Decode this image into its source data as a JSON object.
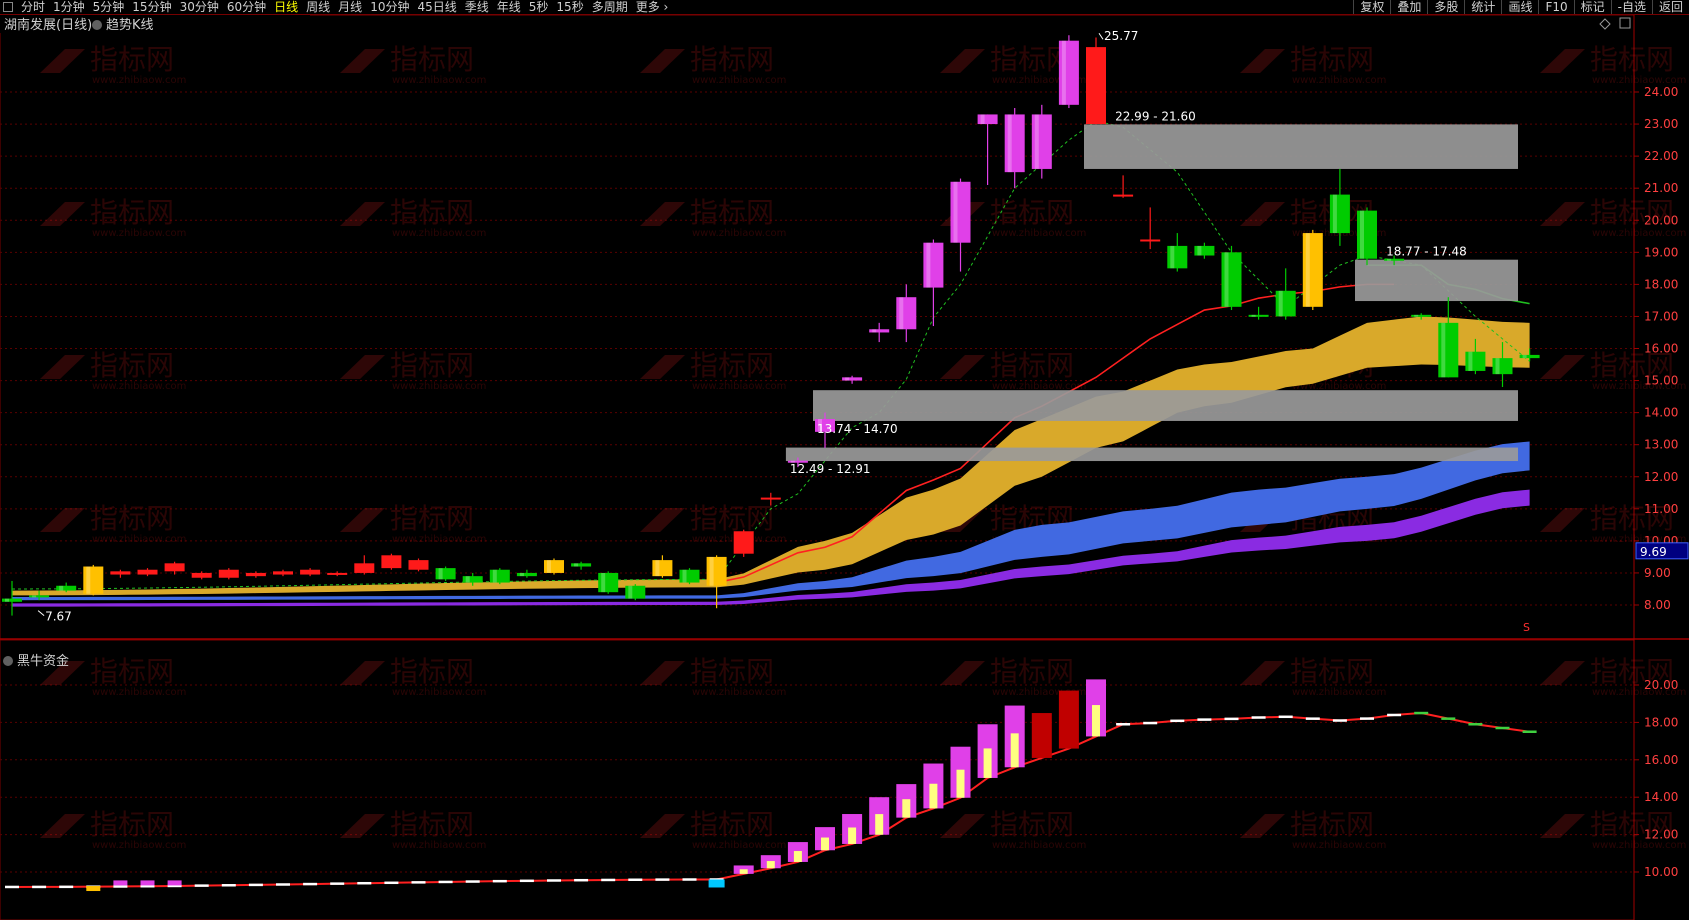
{
  "toolbar": {
    "periods": [
      {
        "label": "分时",
        "active": false
      },
      {
        "label": "1分钟",
        "active": false
      },
      {
        "label": "5分钟",
        "active": false
      },
      {
        "label": "15分钟",
        "active": false
      },
      {
        "label": "30分钟",
        "active": false
      },
      {
        "label": "60分钟",
        "active": false
      },
      {
        "label": "日线",
        "active": true
      },
      {
        "label": "周线",
        "active": false
      },
      {
        "label": "月线",
        "active": false
      },
      {
        "label": "10分钟",
        "active": false
      },
      {
        "label": "45日线",
        "active": false
      },
      {
        "label": "季线",
        "active": false
      },
      {
        "label": "年线",
        "active": false
      },
      {
        "label": "5秒",
        "active": false
      },
      {
        "label": "15秒",
        "active": false
      },
      {
        "label": "多周期",
        "active": false
      },
      {
        "label": "更多",
        "active": false
      }
    ],
    "tools": [
      "复权",
      "叠加",
      "多股",
      "统计",
      "画线",
      "F10",
      "标记",
      "-自选",
      "返回"
    ]
  },
  "main_panel": {
    "title": "湖南发展(日线)",
    "indicator": "趋势K线",
    "price_axis": [
      "24.00",
      "23.00",
      "22.00",
      "21.00",
      "20.00",
      "19.00",
      "18.00",
      "17.00",
      "16.00",
      "15.00",
      "14.00",
      "13.00",
      "12.00",
      "11.00",
      "10.00",
      "9.00",
      "8.00"
    ],
    "current_price": "9.69",
    "high_label": "25.77",
    "low_label": "7.67",
    "zones": [
      {
        "label": "22.99 - 21.60",
        "top": 22.99,
        "bottom": 21.6
      },
      {
        "label": "18.77 - 17.48",
        "top": 18.77,
        "bottom": 17.48
      },
      {
        "label": "13.74 - 14.70",
        "top": 14.7,
        "bottom": 13.74
      },
      {
        "label": "12.49 - 12.91",
        "top": 12.91,
        "bottom": 12.49
      }
    ],
    "marker": "S"
  },
  "sub_panel": {
    "title": "黑牛资金",
    "axis": [
      "20.00",
      "18.00",
      "16.00",
      "14.00",
      "12.00",
      "10.00"
    ]
  },
  "watermark": {
    "text": "指标网",
    "url": "www.zhibiaow.com"
  },
  "colors": {
    "up": "#ff1a1a",
    "down": "#00cc00",
    "magenta": "#e040e8",
    "gold": "#ffc000",
    "band_gold": "#d9a92a",
    "band_blue": "#4169e1",
    "band_purple": "#8a2be2",
    "zone": "#9a9a9a",
    "cyan": "#00c8ff"
  },
  "chart_data": {
    "type": "candlestick",
    "candles": [
      [
        8.2,
        8.1,
        8.75,
        7.67,
        "G"
      ],
      [
        8.25,
        8.3,
        8.45,
        8.15,
        "G"
      ],
      [
        8.45,
        8.6,
        8.7,
        8.4,
        "G"
      ],
      [
        8.35,
        9.2,
        9.25,
        8.3,
        "Y"
      ],
      [
        9.05,
        8.95,
        9.1,
        8.85,
        "R"
      ],
      [
        8.95,
        9.1,
        9.15,
        8.9,
        "R"
      ],
      [
        9.05,
        9.3,
        9.35,
        8.95,
        "R"
      ],
      [
        8.85,
        9.0,
        9.05,
        8.8,
        "R"
      ],
      [
        8.85,
        9.1,
        9.15,
        8.8,
        "R"
      ],
      [
        8.9,
        9.0,
        9.05,
        8.85,
        "R"
      ],
      [
        8.95,
        9.05,
        9.1,
        8.9,
        "R"
      ],
      [
        8.95,
        9.1,
        9.15,
        8.9,
        "R"
      ],
      [
        8.95,
        9.0,
        9.05,
        8.9,
        "R"
      ],
      [
        9.0,
        9.3,
        9.55,
        8.95,
        "R"
      ],
      [
        9.15,
        9.55,
        9.6,
        9.1,
        "R"
      ],
      [
        9.1,
        9.4,
        9.45,
        9.05,
        "R"
      ],
      [
        9.15,
        8.8,
        9.2,
        8.75,
        "G"
      ],
      [
        8.9,
        8.7,
        9.0,
        8.6,
        "G"
      ],
      [
        9.1,
        8.7,
        9.15,
        8.65,
        "G"
      ],
      [
        9.0,
        8.9,
        9.1,
        8.85,
        "G"
      ],
      [
        9.0,
        9.4,
        9.45,
        8.95,
        "Y"
      ],
      [
        9.3,
        9.2,
        9.35,
        9.1,
        "G"
      ],
      [
        9.0,
        8.4,
        9.05,
        8.35,
        "G"
      ],
      [
        8.6,
        8.2,
        8.65,
        8.15,
        "G"
      ],
      [
        8.9,
        9.4,
        9.55,
        8.85,
        "Y"
      ],
      [
        9.1,
        8.7,
        9.15,
        8.65,
        "G"
      ],
      [
        8.6,
        9.5,
        9.55,
        7.9,
        "Y"
      ],
      [
        9.6,
        10.3,
        10.35,
        9.5,
        "R"
      ],
      [
        11.3,
        11.35,
        11.5,
        11.1,
        "R"
      ],
      [
        12.45,
        12.5,
        12.6,
        12.3,
        "M"
      ],
      [
        13.4,
        13.8,
        14.0,
        12.9,
        "M"
      ],
      [
        15.0,
        15.1,
        15.15,
        14.9,
        "M"
      ],
      [
        16.5,
        16.6,
        16.8,
        16.2,
        "M"
      ],
      [
        16.6,
        17.6,
        18.0,
        16.2,
        "M"
      ],
      [
        17.9,
        19.3,
        19.4,
        16.7,
        "M"
      ],
      [
        19.3,
        21.2,
        21.3,
        18.4,
        "M"
      ],
      [
        23.0,
        23.3,
        23.3,
        21.1,
        "M"
      ],
      [
        21.5,
        23.3,
        23.5,
        21.0,
        "M"
      ],
      [
        21.6,
        23.3,
        23.6,
        21.3,
        "M"
      ],
      [
        23.6,
        25.6,
        25.77,
        23.5,
        "M"
      ],
      [
        23.0,
        25.4,
        25.7,
        23.0,
        "R"
      ],
      [
        20.75,
        20.8,
        21.4,
        20.7,
        "R"
      ],
      [
        19.35,
        19.4,
        20.4,
        19.1,
        "R"
      ],
      [
        19.2,
        18.5,
        19.6,
        18.4,
        "G"
      ],
      [
        19.2,
        18.9,
        19.3,
        18.8,
        "G"
      ],
      [
        19.0,
        17.3,
        19.2,
        17.2,
        "G"
      ],
      [
        17.05,
        17.0,
        17.3,
        16.9,
        "G"
      ],
      [
        17.8,
        17.0,
        18.5,
        16.9,
        "G"
      ],
      [
        17.3,
        19.6,
        19.7,
        17.2,
        "Y"
      ],
      [
        20.8,
        19.6,
        21.6,
        19.2,
        "G"
      ],
      [
        20.3,
        18.8,
        20.4,
        18.6,
        "G"
      ],
      [
        18.8,
        18.75,
        18.9,
        18.6,
        "G"
      ],
      [
        17.05,
        17.0,
        17.1,
        16.9,
        "G"
      ],
      [
        16.8,
        15.1,
        17.6,
        15.1,
        "G"
      ],
      [
        15.9,
        15.3,
        16.3,
        15.2,
        "G"
      ],
      [
        15.7,
        15.2,
        16.2,
        14.8,
        "G"
      ],
      [
        15.8,
        15.7,
        16.0,
        15.6,
        "G"
      ]
    ]
  }
}
